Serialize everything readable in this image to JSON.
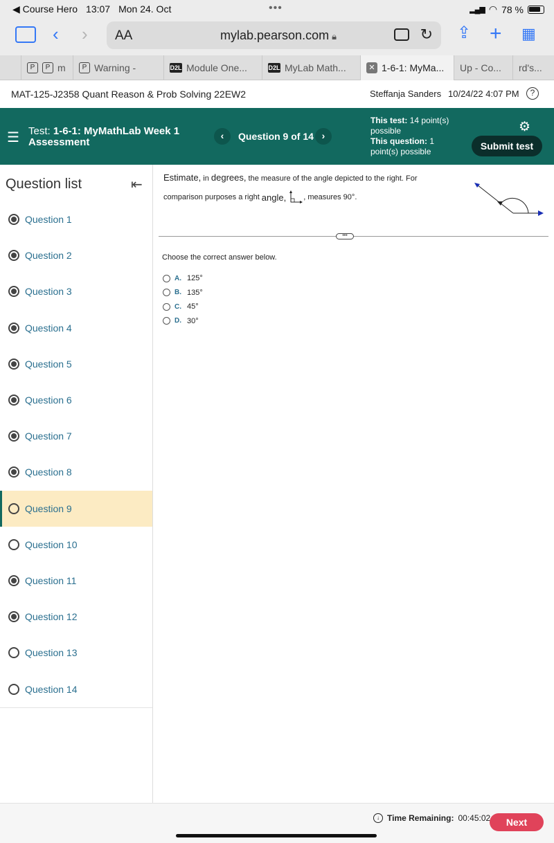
{
  "status_bar": {
    "back_app": "◀ Course Hero",
    "time": "13:07",
    "date": "Mon 24. Oct",
    "battery": "78 %"
  },
  "browser": {
    "text_size_label": "AA",
    "url": "mylab.pearson.com"
  },
  "tabs": [
    {
      "label": "m",
      "favicon": "P"
    },
    {
      "label": "Warning -",
      "favicon": "P"
    },
    {
      "label": "Module One...",
      "favicon": "D2L"
    },
    {
      "label": "MyLab Math...",
      "favicon": "D2L"
    },
    {
      "label": "1-6-1: MyMa...",
      "favicon": "close"
    },
    {
      "label": "Up - Co...",
      "favicon": ""
    },
    {
      "label": "rd's...",
      "favicon": ""
    }
  ],
  "course": {
    "name": "MAT-125-J2358 Quant Reason & Prob Solving 22EW2",
    "user": "Steffanja Sanders",
    "datetime": "10/24/22 4:07 PM",
    "help_label": "?"
  },
  "header": {
    "test_prefix": "Test:",
    "test_name": "1-6-1: MyMathLab Week 1 Assessment",
    "question_counter": "Question 9 of 14",
    "this_test_label": "This test:",
    "this_test_value": "14 point(s) possible",
    "this_question_label": "This question:",
    "this_question_value": "1 point(s) possible",
    "submit_label": "Submit test"
  },
  "sidebar": {
    "title": "Question list",
    "questions": [
      {
        "label": "Question 1",
        "answered": true
      },
      {
        "label": "Question 2",
        "answered": true
      },
      {
        "label": "Question 3",
        "answered": true
      },
      {
        "label": "Question 4",
        "answered": true
      },
      {
        "label": "Question 5",
        "answered": true
      },
      {
        "label": "Question 6",
        "answered": true
      },
      {
        "label": "Question 7",
        "answered": true
      },
      {
        "label": "Question 8",
        "answered": true
      },
      {
        "label": "Question 9",
        "answered": false,
        "current": true
      },
      {
        "label": "Question 10",
        "answered": false
      },
      {
        "label": "Question 11",
        "answered": true
      },
      {
        "label": "Question 12",
        "answered": true
      },
      {
        "label": "Question 13",
        "answered": false
      },
      {
        "label": "Question 14",
        "answered": false
      }
    ]
  },
  "question": {
    "prompt_part1": "Estimate,",
    "prompt_part2": "in",
    "prompt_part3": "degrees,",
    "prompt_part4": "the measure of the angle depicted to the right. For",
    "prompt_line2_a": "comparison purposes a right",
    "prompt_line2_b": "angle,",
    "prompt_line2_c": ", measures 90°.",
    "choose_text": "Choose the correct answer below.",
    "options": [
      {
        "letter": "A.",
        "value": "125°"
      },
      {
        "letter": "B.",
        "value": "135°"
      },
      {
        "letter": "C.",
        "value": "45°"
      },
      {
        "letter": "D.",
        "value": "30°"
      }
    ]
  },
  "footer": {
    "time_label": "Time Remaining:",
    "time_value": "00:45:02",
    "next_label": "Next"
  },
  "colors": {
    "teal": "#12695f",
    "next": "#e0435a",
    "current_row": "#fcebc3",
    "link": "#2a6f8f",
    "ios_blue": "#3478f6"
  }
}
